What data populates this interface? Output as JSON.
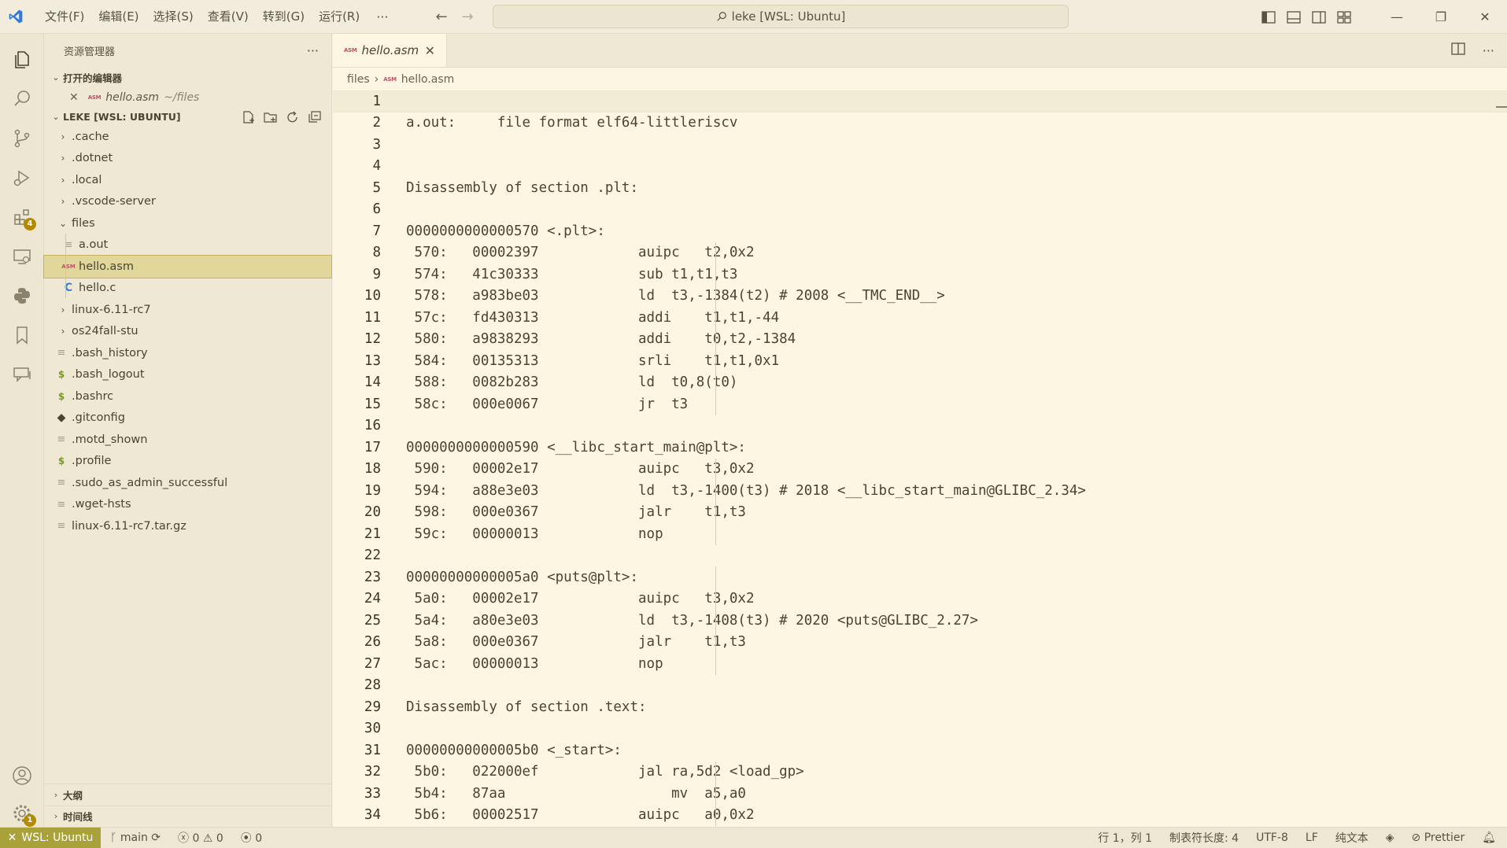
{
  "titlebar": {
    "menus": [
      "文件(F)",
      "编辑(E)",
      "选择(S)",
      "查看(V)",
      "转到(G)",
      "运行(R)"
    ],
    "more": "···",
    "command_center": "leke [WSL: Ubuntu]"
  },
  "activity_badges": {
    "extensions": "4",
    "manage": "1"
  },
  "sidebar": {
    "title": "资源管理器",
    "more": "···",
    "open_editors_label": "打开的编辑器",
    "open_editor": {
      "name": "hello.asm",
      "path": "~/files"
    },
    "workspace_label": "LEKE [WSL: UBUNTU]",
    "tree": [
      {
        "name": ".cache",
        "type": "folder",
        "depth": 0,
        "open": false
      },
      {
        "name": ".dotnet",
        "type": "folder",
        "depth": 0,
        "open": false
      },
      {
        "name": ".local",
        "type": "folder",
        "depth": 0,
        "open": false
      },
      {
        "name": ".vscode-server",
        "type": "folder",
        "depth": 0,
        "open": false
      },
      {
        "name": "files",
        "type": "folder",
        "depth": 0,
        "open": true
      },
      {
        "name": "a.out",
        "type": "lines",
        "depth": 1
      },
      {
        "name": "hello.asm",
        "type": "asm",
        "depth": 1,
        "selected": true
      },
      {
        "name": "hello.c",
        "type": "c",
        "depth": 1
      },
      {
        "name": "linux-6.11-rc7",
        "type": "folder",
        "depth": 0,
        "open": false
      },
      {
        "name": "os24fall-stu",
        "type": "folder",
        "depth": 0,
        "open": false
      },
      {
        "name": ".bash_history",
        "type": "lines",
        "depth": 0
      },
      {
        "name": ".bash_logout",
        "type": "dollar",
        "depth": 0
      },
      {
        "name": ".bashrc",
        "type": "dollar",
        "depth": 0
      },
      {
        "name": ".gitconfig",
        "type": "git",
        "depth": 0
      },
      {
        "name": ".motd_shown",
        "type": "lines",
        "depth": 0
      },
      {
        "name": ".profile",
        "type": "dollar",
        "depth": 0
      },
      {
        "name": ".sudo_as_admin_successful",
        "type": "lines",
        "depth": 0
      },
      {
        "name": ".wget-hsts",
        "type": "lines",
        "depth": 0
      },
      {
        "name": "linux-6.11-rc7.tar.gz",
        "type": "lines",
        "depth": 0
      }
    ],
    "outline_label": "大纲",
    "timeline_label": "时间线"
  },
  "editor": {
    "tab": {
      "name": "hello.asm",
      "tag": "ASM"
    },
    "breadcrumb": {
      "folder": "files",
      "file": "hello.asm"
    },
    "lines": [
      "",
      "a.out:     file format elf64-littleriscv",
      "",
      "",
      "Disassembly of section .plt:",
      "",
      "0000000000000570 <.plt>:",
      " 570:   00002397            auipc   t2,0x2",
      " 574:   41c30333            sub t1,t1,t3",
      " 578:   a983be03            ld  t3,-1384(t2) # 2008 <__TMC_END__>",
      " 57c:   fd430313            addi    t1,t1,-44",
      " 580:   a9838293            addi    t0,t2,-1384",
      " 584:   00135313            srli    t1,t1,0x1",
      " 588:   0082b283            ld  t0,8(t0)",
      " 58c:   000e0067            jr  t3",
      "",
      "0000000000000590 <__libc_start_main@plt>:",
      " 590:   00002e17            auipc   t3,0x2",
      " 594:   a88e3e03            ld  t3,-1400(t3) # 2018 <__libc_start_main@GLIBC_2.34>",
      " 598:   000e0367            jalr    t1,t3",
      " 59c:   00000013            nop",
      "",
      "00000000000005a0 <puts@plt>:",
      " 5a0:   00002e17            auipc   t3,0x2",
      " 5a4:   a80e3e03            ld  t3,-1408(t3) # 2020 <puts@GLIBC_2.27>",
      " 5a8:   000e0367            jalr    t1,t3",
      " 5ac:   00000013            nop",
      "",
      "Disassembly of section .text:",
      "",
      "00000000000005b0 <_start>:",
      " 5b0:   022000ef            jal ra,5d2 <load_gp>",
      " 5b4:   87aa                    mv  a5,a0",
      " 5b6:   00002517            auipc   a0,0x2"
    ]
  },
  "statusbar": {
    "remote": "WSL: Ubuntu",
    "branch": "main",
    "errors": "0",
    "warnings": "0",
    "ports": "0",
    "position": "行 1，列 1",
    "tab_size": "制表符长度: 4",
    "encoding": "UTF-8",
    "eol": "LF",
    "language": "纯文本",
    "prettier": "Prettier"
  }
}
